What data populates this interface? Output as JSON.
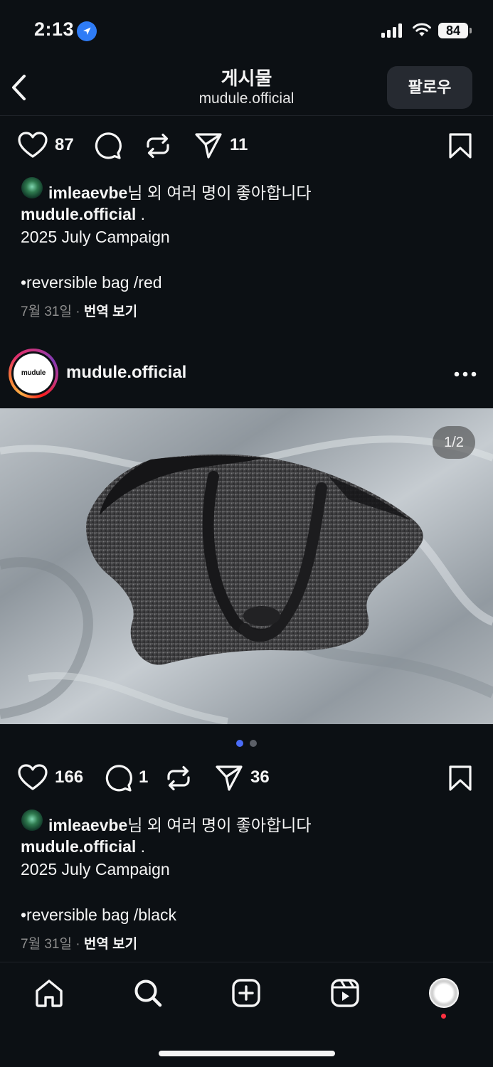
{
  "status_bar": {
    "time": "2:13",
    "battery": "84"
  },
  "header": {
    "title": "게시물",
    "subtitle": "mudule.official",
    "follow_label": "팔로우"
  },
  "post1": {
    "likes": "87",
    "shares": "11",
    "liked_by_user": "imleaevbe",
    "liked_by_suffix": "님 외 여러 명이 좋아합니다",
    "caption_user": "mudule.official",
    "caption_dot": " .",
    "caption_line1": "2025 July Campaign",
    "caption_line2": "•reversible bag /red",
    "date": "7월 31일",
    "sep": " · ",
    "translate": "번역 보기"
  },
  "post2": {
    "author": "mudule.official",
    "avatar_text": "mudule",
    "page_indicator": "1/2",
    "likes": "166",
    "comments": "1",
    "shares": "36",
    "liked_by_user": "imleaevbe",
    "liked_by_suffix": "님 외 여러 명이 좋아합니다",
    "caption_user": "mudule.official",
    "caption_dot": " .",
    "caption_line1": "2025 July Campaign",
    "caption_line2": "•reversible bag /black",
    "date": "7월 31일",
    "sep": " · ",
    "translate": "번역 보기"
  },
  "carousel": {
    "active": 0,
    "count": 2,
    "active_color": "#4a6cf7",
    "inactive_color": "#5c6068"
  },
  "nav": {
    "items": [
      "home-icon",
      "search-icon",
      "create-icon",
      "reels-icon",
      "profile-avatar"
    ]
  },
  "colors": {
    "background": "#0c1014",
    "button": "#262a31",
    "text": "#f5f5f5",
    "muted": "#8e8e8e",
    "notification": "#ff3040"
  }
}
